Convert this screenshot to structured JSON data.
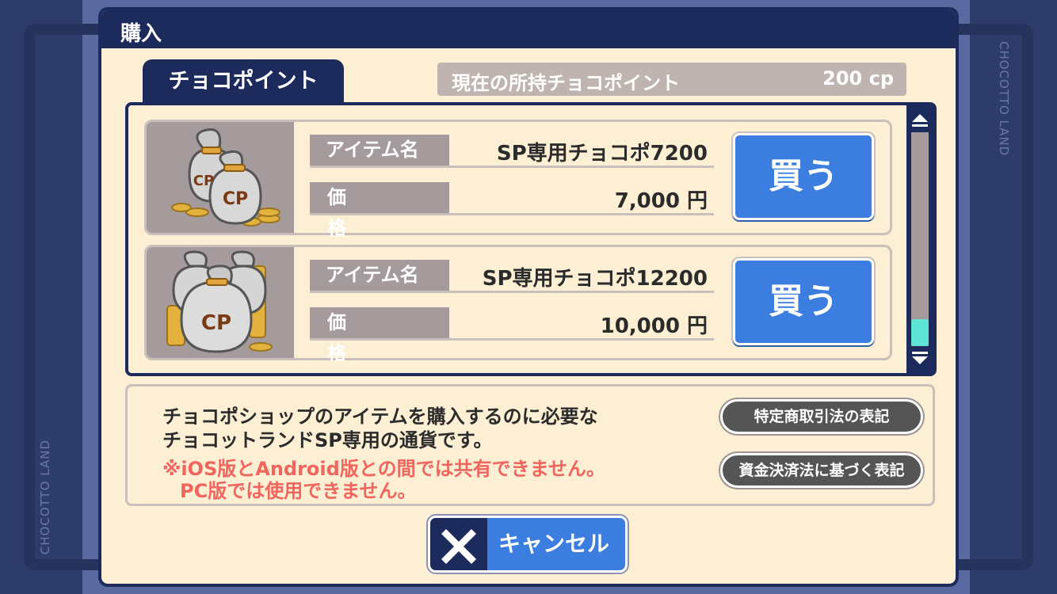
{
  "background": {
    "brand_text": "CHOCOTTO LAND"
  },
  "dialog": {
    "title": "購入",
    "tab_label": "チョコポイント",
    "balance": {
      "label": "現在の所持チョコポイント",
      "value": "200 cp"
    }
  },
  "items": [
    {
      "thumb_icon": "money-bag-icon",
      "name_label": "アイテム名",
      "name": "SP専用チョコポ7200",
      "price_label": "価格",
      "price": "7,000 円",
      "buy_label": "買う"
    },
    {
      "thumb_icon": "money-bags-icon",
      "name_label": "アイテム名",
      "name": "SP専用チョコポ12200",
      "price_label": "価格",
      "price": "10,000 円",
      "buy_label": "買う"
    }
  ],
  "scrollbar": {
    "position": 1.0
  },
  "info": {
    "line1": "チョコポショップのアイテムを購入するのに必要な",
    "line2": "チョコットランドSP専用の通貨です。",
    "warning1": "※iOS版とAndroid版との間では共有できません。",
    "warning2": "PC版では使用できません。",
    "legal_button_1": "特定商取引法の表記",
    "legal_button_2": "資金決済法に基づく表記"
  },
  "cancel": {
    "label": "キャンセル"
  },
  "colors": {
    "navy": "#1d2a5c",
    "cream": "#fcefd4",
    "blue_button": "#3c7ee0",
    "gray_label": "#a59b9c",
    "warning_red": "#f0665e",
    "scroll_thumb": "#5fe3d4"
  }
}
